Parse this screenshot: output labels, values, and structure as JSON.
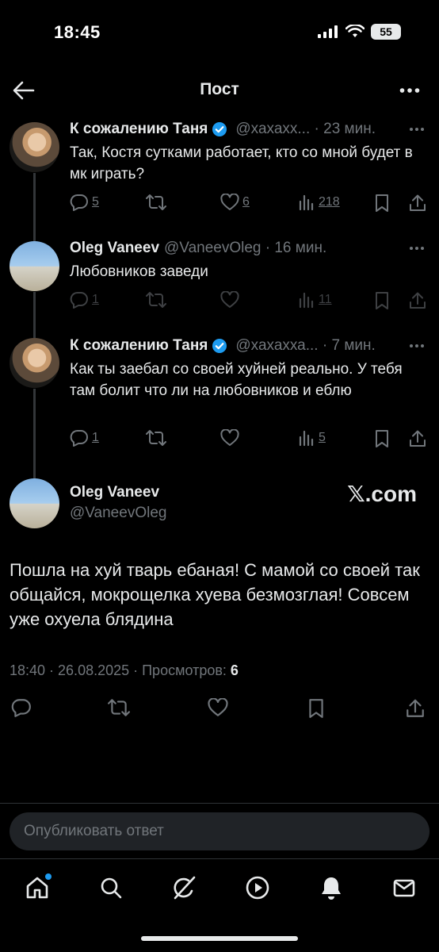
{
  "status": {
    "time": "18:45",
    "battery": "55"
  },
  "header": {
    "title": "Пост"
  },
  "thread": [
    {
      "name": "К сожалению Таня",
      "verified": true,
      "handle": "@хахахх...",
      "time": "23 мин.",
      "text": "Так, Костя сутками работает, кто со мной будет в мк играть?",
      "replies": "5",
      "likes": "6",
      "views": "218"
    },
    {
      "name": "Oleg Vaneev",
      "verified": false,
      "handle": "@VaneevOleg",
      "time": "16 мин.",
      "text": "Любовников заведи",
      "replies": "1",
      "likes": "",
      "views": "11"
    },
    {
      "name": "К сожалению Таня",
      "verified": true,
      "handle": "@хахахха...",
      "time": "7 мин.",
      "text": "Как ты заебал со своей хуйней реально. У тебя там болит что ли на любовников и еблю",
      "replies": "1",
      "likes": "",
      "views": "5"
    }
  ],
  "main_post": {
    "name": "Oleg Vaneev",
    "handle": "@VaneevOleg",
    "watermark": "𝕏.com",
    "text": "Пошла на хуй тварь ебаная! С мамой со своей так общайся, мокрощелка хуева безмозглая! Совсем уже охуела блядина",
    "meta": "18:40 · 26.08.2025 · Просмотров: ",
    "views": "6"
  },
  "reply": {
    "placeholder": "Опубликовать ответ"
  },
  "colors": {
    "accent": "#1d9bf0",
    "muted": "#71767b",
    "text": "#e7e9ea",
    "background": "#000000"
  },
  "icons": [
    "back-arrow-icon",
    "more-icon",
    "verified-icon",
    "reply-icon",
    "retweet-icon",
    "like-icon",
    "views-icon",
    "bookmark-icon",
    "share-icon",
    "home-icon",
    "search-icon",
    "grok-icon",
    "video-icon",
    "bell-icon",
    "mail-icon"
  ]
}
